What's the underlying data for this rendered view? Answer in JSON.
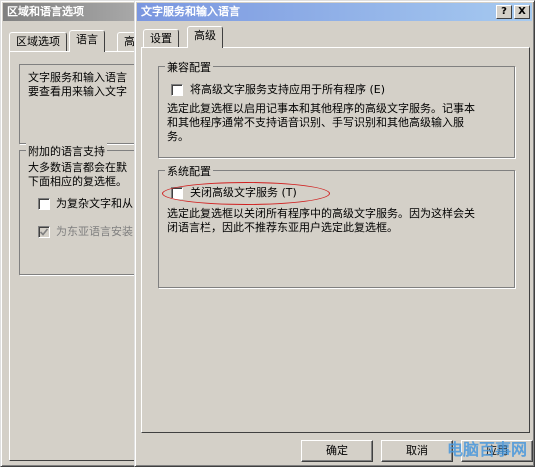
{
  "back_window": {
    "title": "区域和语言选项",
    "tabs": [
      "区域选项",
      "语言",
      "高"
    ],
    "group1": {
      "lines": [
        "文字服务和输入语言",
        "要查看用来输入文字"
      ]
    },
    "group2": {
      "label": "附加的语言支持",
      "lines": [
        "大多数语言都会在默",
        "下面相应的复选框。"
      ],
      "check1": "为复杂文字和从",
      "check2": "为东亚语言安装"
    }
  },
  "front_window": {
    "title": "文字服务和输入语言",
    "help_btn": "?",
    "close_btn": "X",
    "tabs": [
      "设置",
      "高级"
    ],
    "compat": {
      "label": "兼容配置",
      "check_label": "将高级文字服务支持应用于所有程序 (E)",
      "desc": [
        "选定此复选框以启用记事本和其他程序的高级文字服务。记事本",
        "和其他程序通常不支持语音识别、手写识别和其他高级输入服",
        "务。"
      ]
    },
    "system": {
      "label": "系统配置",
      "check_label": "关闭高级文字服务 (T)",
      "desc": [
        "选定此复选框以关闭所有程序中的高级文字服务。因为这样会关",
        "闭语言栏，因此不推荐东亚用户选定此复选框。"
      ]
    },
    "buttons": {
      "ok": "确定",
      "cancel": "取消",
      "apply": "应用"
    }
  },
  "watermark": "电脑百事网",
  "colors": {
    "face": "#d4d0c8",
    "highlight_ellipse": "#d02020"
  }
}
